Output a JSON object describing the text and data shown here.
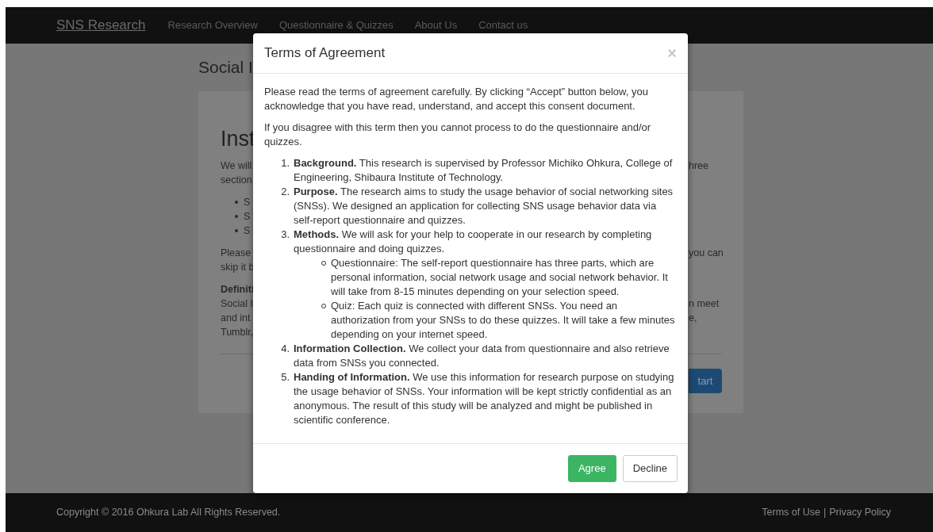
{
  "navbar": {
    "brand": "SNS Research",
    "links": [
      "Research Overview",
      "Questionnaire & Quizzes",
      "About Us",
      "Contact us"
    ]
  },
  "page": {
    "heading": "Social I",
    "card": {
      "title": "Inst",
      "paragraphs": [
        {
          "kind": "text",
          "lines": [
            {
              "left": "We will",
              "right": "hree"
            },
            {
              "left": "section"
            }
          ]
        },
        {
          "kind": "list",
          "lines": [
            {
              "left": "S"
            },
            {
              "left": "S"
            },
            {
              "left": "S"
            }
          ]
        },
        {
          "kind": "text",
          "lines": [
            {
              "left": "Please",
              "right": "you can"
            },
            {
              "left": "skip it b"
            }
          ]
        },
        {
          "kind": "text",
          "lines": [
            {
              "left": "**Definiti**"
            },
            {
              "left": "Social I",
              "right": "n meet"
            },
            {
              "left": "and int",
              "right": "e,"
            },
            {
              "left": "Tumblr,"
            }
          ]
        }
      ],
      "button": "tart"
    }
  },
  "modal": {
    "title": "Terms of Agreement",
    "close": "×",
    "paragraphs": [
      "Please read the terms of agreement carefully. By clicking “Accept” button below, you acknowledge that you have read, understand, and accept this consent document.",
      "If you disagree with this term then you cannot process to do the questionnaire and/or quizzes."
    ],
    "items": [
      {
        "number": "1.",
        "text": "**Background.** This research is supervised by Professor Michiko Ohkura, College of Engineering, Shibaura Institute of Technology."
      },
      {
        "number": "2.",
        "text": "**Purpose.** The research aims to study the usage behavior of social networking sites (SNSs). We designed an application for collecting SNS usage behavior data via self-report questionnaire and quizzes."
      },
      {
        "number": "3.",
        "text": "**Methods.** We will ask for your help to cooperate in our research by completing questionnaire and doing quizzes.",
        "subitems": [
          "Questionnaire: The self-report questionnaire has three parts, which are personal information, social network usage and social network behavior. It will take from 8-15 minutes depending on your selection speed.",
          "Quiz: Each quiz is connected with different SNSs. You need an authorization from your SNSs to do these quizzes. It will take a few minutes depending on your internet speed."
        ]
      },
      {
        "number": "4.",
        "text": "**Information Collection.** We collect your data from questionnaire and also retrieve data from SNSs you connected."
      },
      {
        "number": "5.",
        "text": "**Handing of Information.** We use this information for research purpose on studying the usage behavior of SNSs. Your information will be kept strictly confidential as an anonymous. The result of this study will be analyzed and might be published in scientific conference."
      }
    ],
    "buttons": [
      {
        "label": "Agree",
        "kind": "primary"
      },
      {
        "label": "Decline",
        "kind": "secondary"
      }
    ]
  },
  "footer": {
    "copyright": "Copyright © 2016 Ohkura Lab All Rights Reserved.",
    "links": [
      "Terms of Use",
      "Privacy Policy"
    ],
    "separator": "|"
  }
}
